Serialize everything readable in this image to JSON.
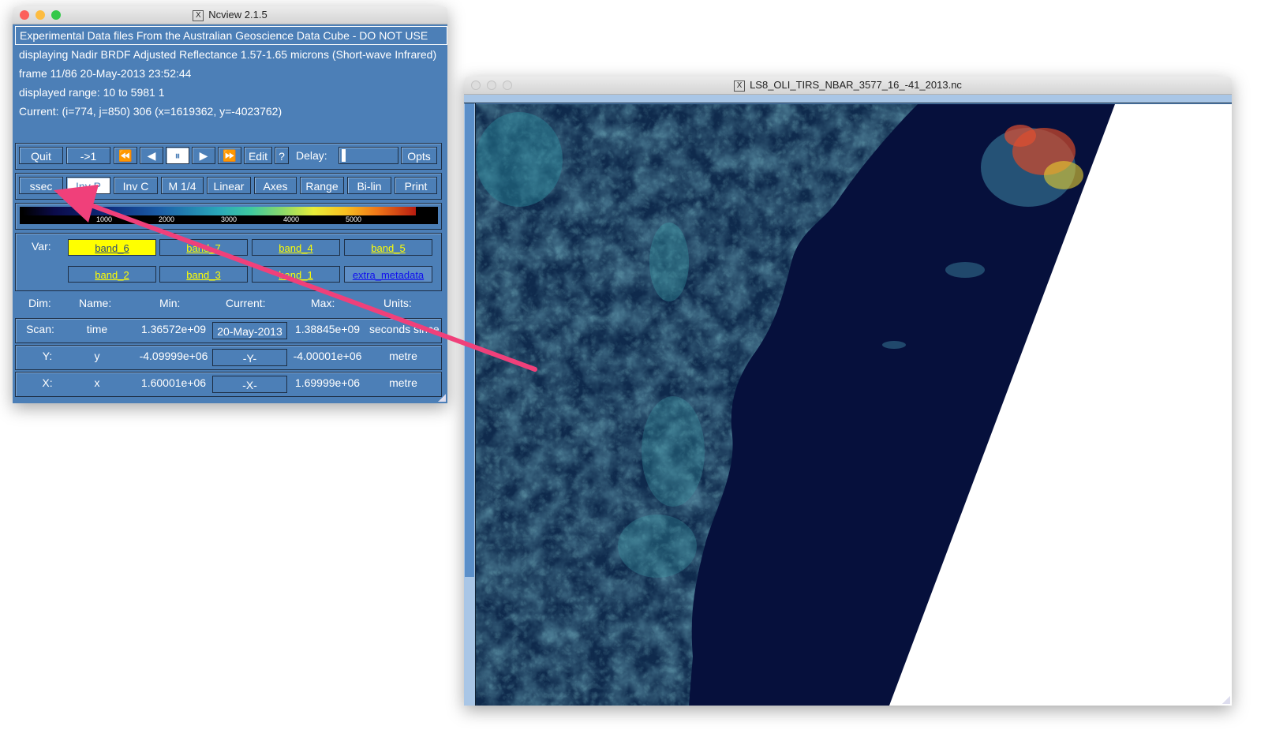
{
  "control_window": {
    "title": "Ncview 2.1.5",
    "info_lines": {
      "title": "Experimental Data files From the Australian Geoscience Data Cube - DO NOT USE",
      "displaying": "displaying Nadir BRDF Adjusted Reflectance 1.57-1.65 microns (Short-wave Infrared)",
      "frame": "frame 11/86 20-May-2013 23:52:44",
      "range": "displayed range: 10 to 5981 1",
      "current": "Current: (i=774, j=850) 306 (x=1619362, y=-4023762)"
    },
    "toolbar1": {
      "quit": "Quit",
      "goto_first": "->1",
      "rewind_icon": "⏪",
      "back_icon": "◀",
      "pause_icon": "⏸",
      "forward_icon": "▶",
      "fastforward_icon": "⏩",
      "edit": "Edit",
      "help": "?",
      "delay_label": "Delay:",
      "opts": "Opts"
    },
    "toolbar2": {
      "colormap": "ssec",
      "inv_p": "Inv P",
      "inv_c": "Inv C",
      "mag": "M 1/4",
      "linear": "Linear",
      "axes": "Axes",
      "range": "Range",
      "bilin": "Bi-lin",
      "print": "Print"
    },
    "colorbar": {
      "ticks": [
        "1000",
        "2000",
        "3000",
        "4000",
        "5000"
      ]
    },
    "vars": {
      "label": "Var:",
      "row1": [
        "band_6",
        "band_7",
        "band_4",
        "band_5"
      ],
      "row2": [
        "band_2",
        "band_3",
        "band_1",
        "extra_metadata"
      ],
      "selected": "band_6"
    },
    "dims": {
      "headers": [
        "Dim:",
        "Name:",
        "Min:",
        "Current:",
        "Max:",
        "Units:"
      ],
      "rows": [
        {
          "dim": "Scan:",
          "name": "time",
          "min": "1.36572e+09",
          "current": "20-May-2013",
          "max": "1.38845e+09",
          "units": "seconds since"
        },
        {
          "dim": "Y:",
          "name": "y",
          "min": "-4.09999e+06",
          "current": "-Y-",
          "max": "-4.00001e+06",
          "units": "metre"
        },
        {
          "dim": "X:",
          "name": "x",
          "min": "1.60001e+06",
          "current": "-X-",
          "max": "1.69999e+06",
          "units": "metre"
        }
      ]
    }
  },
  "image_window": {
    "title": "LS8_OLI_TIRS_NBAR_3577_16_-41_2013.nc"
  },
  "annotation": {
    "arrow_color": "#f0407a"
  },
  "colors": {
    "panel_blue": "#4c7fb7",
    "water": "#06103c",
    "selected_var": "#ffff00"
  }
}
